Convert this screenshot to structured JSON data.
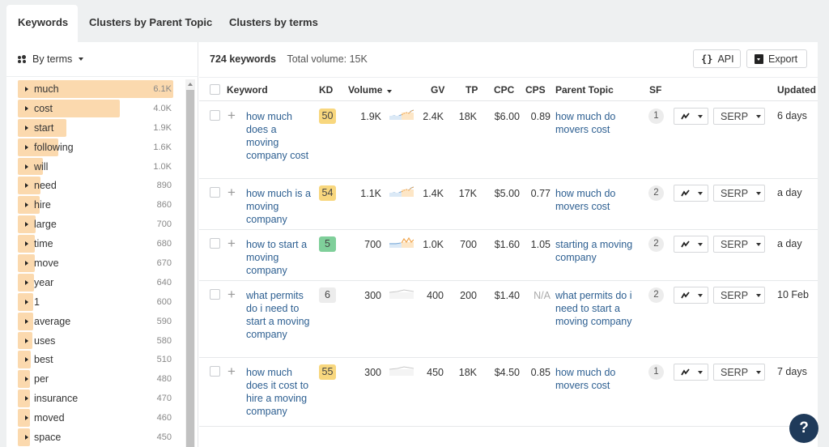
{
  "tabs": [
    {
      "label": "Keywords",
      "active": true
    },
    {
      "label": "Clusters by Parent Topic",
      "active": false
    },
    {
      "label": "Clusters by terms",
      "active": false
    }
  ],
  "sidebar": {
    "grouping_label": "By terms",
    "terms": [
      {
        "term": "much",
        "count": "6.1K",
        "value": 6100
      },
      {
        "term": "cost",
        "count": "4.0K",
        "value": 4000
      },
      {
        "term": "start",
        "count": "1.9K",
        "value": 1900
      },
      {
        "term": "following",
        "count": "1.6K",
        "value": 1600
      },
      {
        "term": "will",
        "count": "1.0K",
        "value": 1000
      },
      {
        "term": "need",
        "count": "890",
        "value": 890
      },
      {
        "term": "hire",
        "count": "860",
        "value": 860
      },
      {
        "term": "large",
        "count": "700",
        "value": 700
      },
      {
        "term": "time",
        "count": "680",
        "value": 680
      },
      {
        "term": "move",
        "count": "670",
        "value": 670
      },
      {
        "term": "year",
        "count": "640",
        "value": 640
      },
      {
        "term": "1",
        "count": "600",
        "value": 600
      },
      {
        "term": "average",
        "count": "590",
        "value": 590
      },
      {
        "term": "uses",
        "count": "580",
        "value": 580
      },
      {
        "term": "best",
        "count": "510",
        "value": 510
      },
      {
        "term": "per",
        "count": "480",
        "value": 480
      },
      {
        "term": "insurance",
        "count": "470",
        "value": 470
      },
      {
        "term": "moved",
        "count": "460",
        "value": 460
      },
      {
        "term": "space",
        "count": "450",
        "value": 450
      }
    ]
  },
  "summary": {
    "keywords_count": "724 keywords",
    "total_volume": "Total volume: 15K"
  },
  "toolbar": {
    "api_label": "API",
    "export_label": "Export"
  },
  "table": {
    "columns": {
      "keyword": "Keyword",
      "kd": "KD",
      "volume": "Volume",
      "gv": "GV",
      "tp": "TP",
      "cpc": "CPC",
      "cps": "CPS",
      "parent_topic": "Parent Topic",
      "sf": "SF",
      "updated": "Updated"
    },
    "serp_label": "SERP",
    "rows": [
      {
        "keyword": "how much does a moving company cost",
        "kd": "50",
        "kd_color": "#f8d77e",
        "volume": "1.9K",
        "trend": "rising",
        "gv": "2.4K",
        "tp": "18K",
        "cpc": "$6.00",
        "cps": "0.89",
        "parent_topic": "how much do movers cost",
        "sf": "1",
        "updated": "6 days"
      },
      {
        "keyword": "how much is a moving company",
        "kd": "54",
        "kd_color": "#f8d77e",
        "volume": "1.1K",
        "trend": "rising",
        "gv": "1.4K",
        "tp": "17K",
        "cpc": "$5.00",
        "cps": "0.77",
        "parent_topic": "how much do movers cost",
        "sf": "2",
        "updated": "a day"
      },
      {
        "keyword": "how to start a moving company",
        "kd": "5",
        "kd_color": "#7fcf9a",
        "volume": "700",
        "trend": "spiky",
        "gv": "1.0K",
        "tp": "700",
        "cpc": "$1.60",
        "cps": "1.05",
        "parent_topic": "starting a moving company",
        "sf": "2",
        "updated": "a day"
      },
      {
        "keyword": "what permits do i need to start a moving company",
        "kd": "6",
        "kd_color": "#ececec",
        "volume": "300",
        "trend": "flat",
        "gv": "400",
        "tp": "200",
        "cpc": "$1.40",
        "cps": "N/A",
        "parent_topic": "what permits do i need to start a moving company",
        "sf": "2",
        "updated": "10 Feb"
      },
      {
        "keyword": "how much does it cost to hire a moving company",
        "kd": "55",
        "kd_color": "#f8d77e",
        "volume": "300",
        "trend": "flat",
        "gv": "450",
        "tp": "18K",
        "cpc": "$4.50",
        "cps": "0.85",
        "parent_topic": "how much do movers cost",
        "sf": "1",
        "updated": "7 days"
      }
    ]
  },
  "help_label": "?"
}
